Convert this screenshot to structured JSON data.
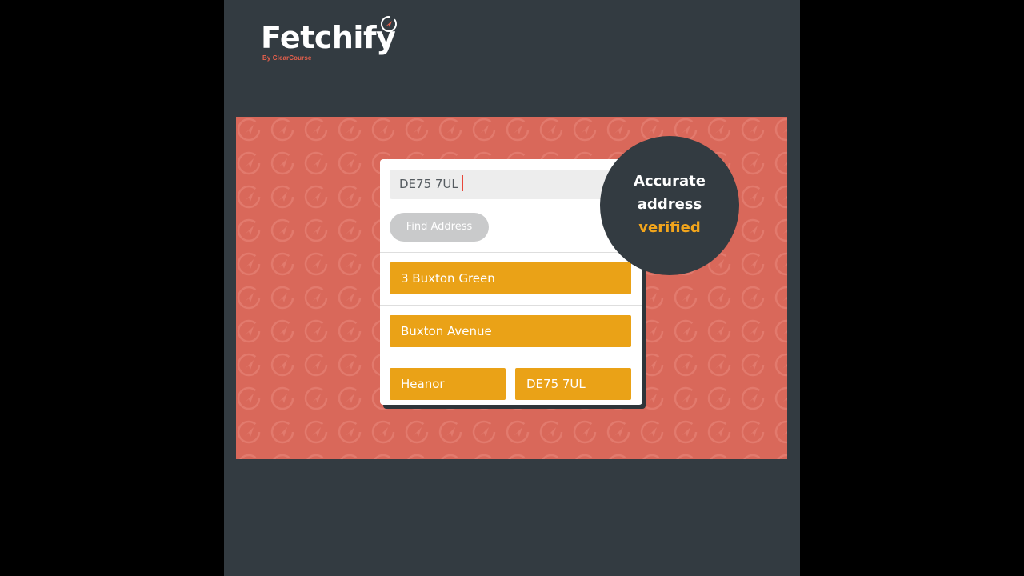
{
  "brand": {
    "name": "Fetchify",
    "byline": "By ClearCourse",
    "accent_color": "#e8604c",
    "icon": "compass-icon"
  },
  "banner": {
    "background_color": "#d9685a",
    "pattern_icon": "compass-icon"
  },
  "form": {
    "postcode_value": "DE75 7UL",
    "find_button_label": "Find Address",
    "results": {
      "address_line_1": "3 Buxton Green",
      "address_line_2": "Buxton Avenue",
      "town": "Heanor",
      "postcode": "DE75 7UL"
    },
    "field_color": "#eaa217"
  },
  "callout": {
    "line1": "Accurate",
    "line2": "address",
    "line3": "verified",
    "highlight_color": "#f2a51c"
  }
}
